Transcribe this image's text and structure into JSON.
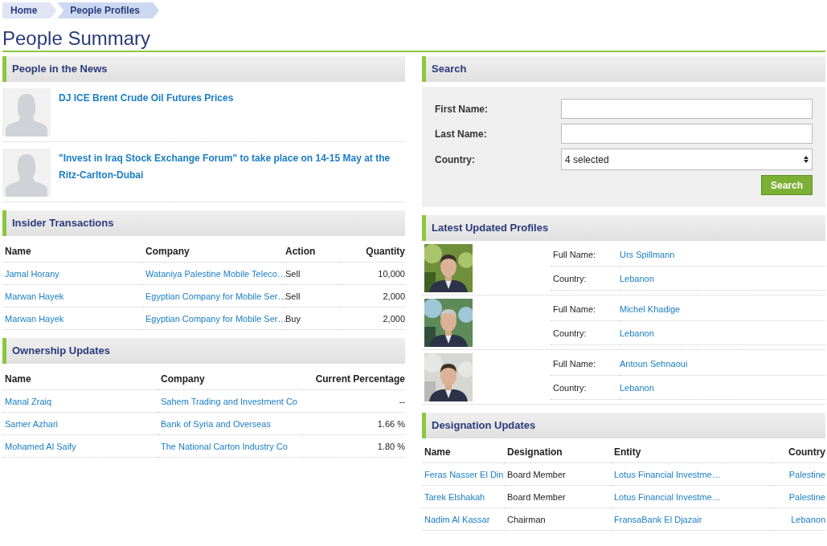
{
  "breadcrumb": [
    {
      "label": "Home"
    },
    {
      "label": "People Profiles"
    }
  ],
  "title": "People Summary",
  "news": {
    "title": "People in the News",
    "items": [
      {
        "headline": "DJ ICE Brent Crude Oil Futures Prices"
      },
      {
        "headline": "\"Invest in Iraq Stock Exchange Forum\" to take place on 14-15 May at the Ritz-Carlton-Dubai"
      }
    ]
  },
  "insider": {
    "title": "Insider Transactions",
    "columns": [
      {
        "label": "Name",
        "kind": "link"
      },
      {
        "label": "Company",
        "kind": "link"
      },
      {
        "label": "Action",
        "kind": "text"
      },
      {
        "label": "Quantity",
        "kind": "number"
      }
    ],
    "rows": [
      [
        "Jamal Horany",
        "Wataniya Palestine Mobile Teleco…",
        "Sell",
        "10,000"
      ],
      [
        "Marwan Hayek",
        "Egyptian Company for Mobile Ser…",
        "Sell",
        "2,000"
      ],
      [
        "Marwan Hayek",
        "Egyptian Company for Mobile Ser…",
        "Buy",
        "2,000"
      ]
    ]
  },
  "ownership": {
    "title": "Ownership Updates",
    "columns": [
      {
        "label": "Name",
        "kind": "link"
      },
      {
        "label": "Company",
        "kind": "link"
      },
      {
        "label": "Current Percentage",
        "kind": "number"
      }
    ],
    "rows": [
      [
        "Manal Zraiq",
        "Sahem Trading and Investment Co",
        "--"
      ],
      [
        "Samer Azhari",
        "Bank of Syria and Overseas",
        "1.66 %"
      ],
      [
        "Mohamed Al Saify",
        "The National Carton Industry Co",
        "1.80 %"
      ]
    ]
  },
  "search": {
    "title": "Search",
    "fields": [
      {
        "label": "First Name:",
        "kind": "text"
      },
      {
        "label": "Last Name:",
        "kind": "text"
      },
      {
        "label": "Country:",
        "kind": "select",
        "value": "4 selected"
      }
    ],
    "button": "Search"
  },
  "profiles": {
    "title": "Latest Updated Profiles",
    "items": [
      {
        "kind": "picture",
        "full_name_label": "Full Name:",
        "full_name": "Urs Spillmann",
        "country_label": "Country:",
        "country": "Lebanon"
      },
      {
        "kind": "picture",
        "full_name_label": "Full Name:",
        "full_name": "Michel Khadige",
        "country_label": "Country:",
        "country": "Lebanon"
      },
      {
        "kind": "picture",
        "full_name_label": "Full Name:",
        "full_name": "Antoun Sehnaoui",
        "country_label": "Country:",
        "country": "Lebanon"
      }
    ]
  },
  "designation": {
    "title": "Designation Updates",
    "columns": [
      {
        "label": "Name",
        "kind": "link"
      },
      {
        "label": "Designation",
        "kind": "text"
      },
      {
        "label": "Entity",
        "kind": "link"
      },
      {
        "label": "Country",
        "kind": "link-right"
      }
    ],
    "rows": [
      [
        "Feras Nasser El Din",
        "Board Member",
        "Lotus Financial Investme…",
        "Palestine"
      ],
      [
        "Tarek Elshakah",
        "Board Member",
        "Lotus Financial Investme…",
        "Palestine"
      ],
      [
        "Nadim Al Kassar",
        "Chairman",
        "FransaBank El Djazair",
        "Lebanon"
      ]
    ]
  }
}
